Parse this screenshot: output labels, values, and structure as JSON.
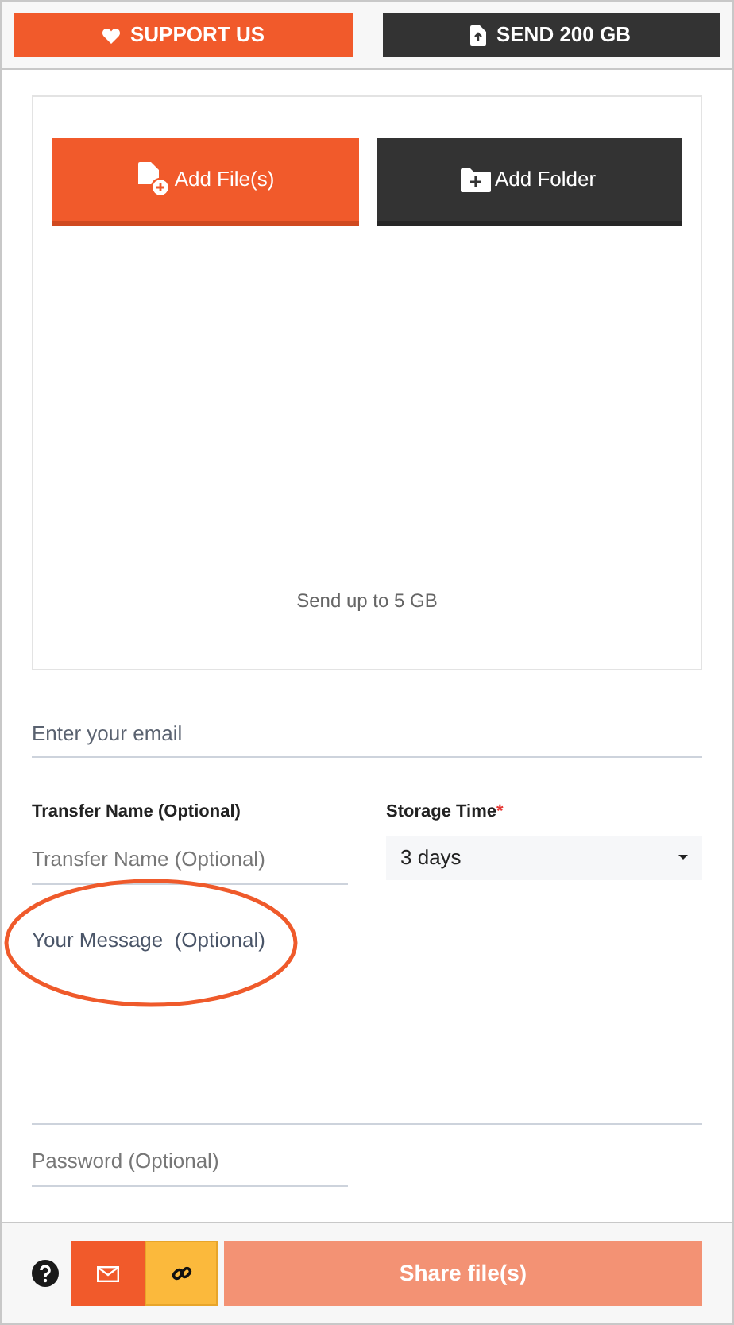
{
  "top_buttons": [
    {
      "kind": "support",
      "label": "SUPPORT US"
    },
    {
      "kind": "send",
      "label": "SEND 200 GB"
    }
  ],
  "upload": {
    "buttons": [
      {
        "kind": "files",
        "label": "Add File(s)"
      },
      {
        "kind": "folder",
        "label": "Add Folder"
      }
    ],
    "hint": "Send up to 5 GB"
  },
  "email": {
    "placeholder": "Enter your email"
  },
  "transfer_name": {
    "label": "Transfer Name (Optional)",
    "placeholder": "Transfer Name (Optional)"
  },
  "storage_time": {
    "label": "Storage Time",
    "required_mark": "*",
    "value": "3 days"
  },
  "message": {
    "placeholder": "Your Message  (Optional)"
  },
  "password": {
    "placeholder": "Password (Optional)"
  },
  "share_modes": [
    {
      "kind": "email",
      "selected": false
    },
    {
      "kind": "link",
      "selected": true
    }
  ],
  "share_button": {
    "label": "Share file(s)",
    "disabled": true
  }
}
